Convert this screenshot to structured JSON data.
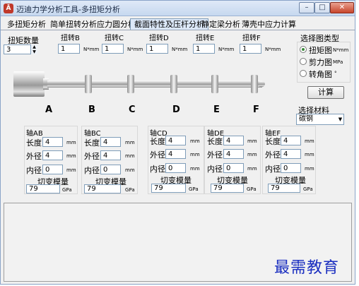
{
  "window": {
    "title": "迈迪力学分析工具-多扭矩分析",
    "icon_glyph": "Ā",
    "min_glyph": "–",
    "max_glyph": "□",
    "close_glyph": "✕"
  },
  "tabs": [
    "多扭矩分析",
    "简单扭转分析",
    "应力圆分析",
    "截面特性及压杆分析",
    "静定梁分析",
    "薄壳中应力计算"
  ],
  "active_tab": 3,
  "torque_count": {
    "label": "扭矩数量",
    "value": "3"
  },
  "torques": [
    {
      "label": "扭转B",
      "value": "1",
      "unit": "N*mm"
    },
    {
      "label": "扭转C",
      "value": "1",
      "unit": "N*mm"
    },
    {
      "label": "扭转D",
      "value": "1",
      "unit": "N*mm"
    },
    {
      "label": "扭转E",
      "value": "1",
      "unit": "N*mm"
    },
    {
      "label": "扭转F",
      "value": "1",
      "unit": "N*mm"
    }
  ],
  "stations": [
    "A",
    "B",
    "C",
    "D",
    "E",
    "F"
  ],
  "chart_type": {
    "label": "选择图类型",
    "options": [
      {
        "label": "扭矩图",
        "unit": "N*mm",
        "selected": true
      },
      {
        "label": "剪力图",
        "unit": "MPa",
        "selected": false
      },
      {
        "label": "转角图",
        "unit": "°",
        "selected": false
      }
    ]
  },
  "calculate_button": "计算",
  "material": {
    "label": "选择材料",
    "value": "碳钢"
  },
  "shafts": [
    {
      "title": "轴AB",
      "length_label": "长度",
      "length": "4",
      "outer_label": "外径",
      "outer": "4",
      "inner_label": "内径",
      "inner": "0",
      "unit": "mm",
      "modulus_label": "切变模量",
      "modulus": "79",
      "modulus_unit": "GPa"
    },
    {
      "title": "轴BC",
      "length_label": "长度",
      "length": "4",
      "outer_label": "外径",
      "outer": "4",
      "inner_label": "内径",
      "inner": "0",
      "unit": "mm",
      "modulus_label": "切变模量",
      "modulus": "79",
      "modulus_unit": "GPa"
    },
    {
      "title": "轴CD",
      "length_label": "长度",
      "length": "4",
      "outer_label": "外径",
      "outer": "4",
      "inner_label": "内径",
      "inner": "0",
      "unit": "mm",
      "modulus_label": "切变模量",
      "modulus": "79",
      "modulus_unit": "GPa"
    },
    {
      "title": "轴DE",
      "length_label": "长度",
      "length": "4",
      "outer_label": "外径",
      "outer": "4",
      "inner_label": "内径",
      "inner": "0",
      "unit": "mm",
      "modulus_label": "切变模量",
      "modulus": "79",
      "modulus_unit": "GPa"
    },
    {
      "title": "轴EF",
      "length_label": "长度",
      "length": "4",
      "outer_label": "外径",
      "outer": "4",
      "inner_label": "内径",
      "inner": "0",
      "unit": "mm",
      "modulus_label": "切变模量",
      "modulus": "79",
      "modulus_unit": "GPa"
    }
  ],
  "watermark": "最需教育"
}
